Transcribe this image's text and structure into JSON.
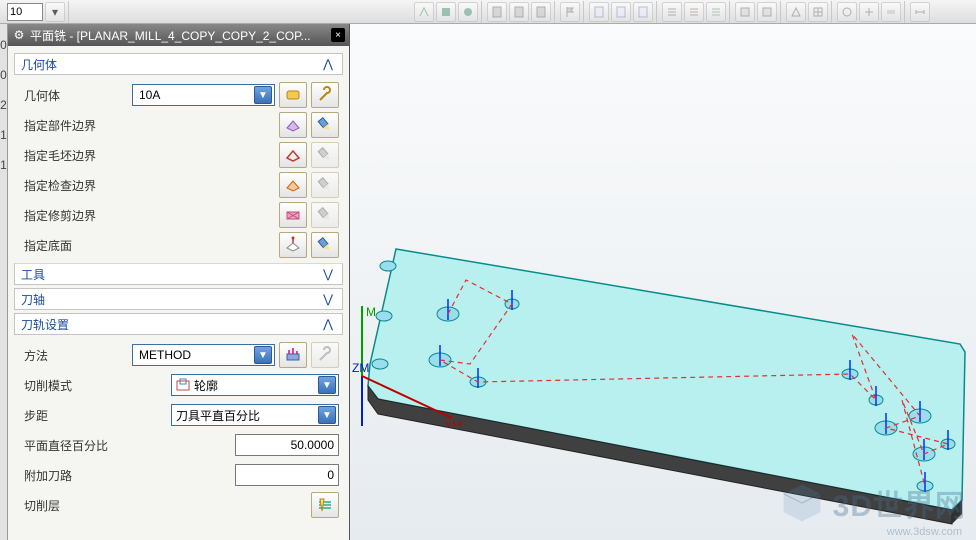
{
  "top_input": "10",
  "dialog": {
    "title": "平面铣 - [PLANAR_MILL_4_COPY_COPY_2_COP...",
    "close": "×"
  },
  "sections": {
    "geom": {
      "header": "几何体",
      "body_label": "几何体",
      "body_value": "10A",
      "part_bound": "指定部件边界",
      "blank_bound": "指定毛坯边界",
      "check_bound": "指定检查边界",
      "trim_bound": "指定修剪边界",
      "floor": "指定底面"
    },
    "tool": {
      "header": "工具"
    },
    "axis": {
      "header": "刀轴"
    },
    "path": {
      "header": "刀轨设置",
      "method_label": "方法",
      "method_value": "METHOD",
      "cut_mode_label": "切削模式",
      "cut_mode_value": "轮廓",
      "step_label": "步距",
      "step_value": "刀具平直百分比",
      "flat_pct_label": "平面直径百分比",
      "flat_pct_value": "50.0000",
      "extra_label": "附加刀路",
      "extra_value": "0",
      "cut_level_label": "切削层"
    }
  },
  "axis_labels": {
    "ym": "M",
    "zm": "ZM",
    "xm": "XM"
  },
  "left_rail": [
    "0",
    "0",
    "2",
    "1",
    "1"
  ],
  "watermark": {
    "text": "3D世界网",
    "sub": "www.3dsw.com"
  }
}
